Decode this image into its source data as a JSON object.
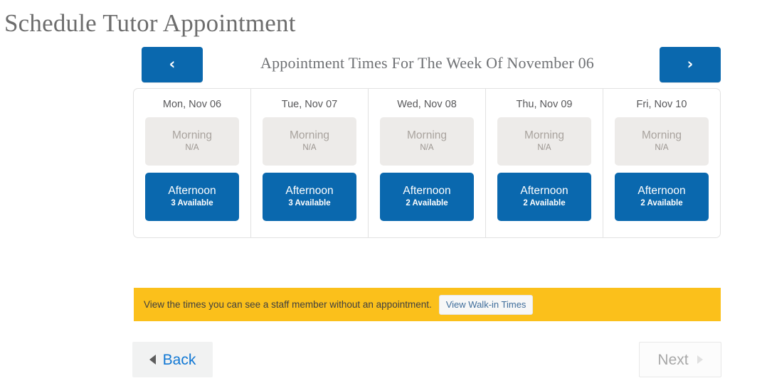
{
  "page": {
    "title": "Schedule Tutor Appointment"
  },
  "week_nav": {
    "prev_icon": "chevron-left-icon",
    "prev_glyph": "‹",
    "next_icon": "chevron-right-icon",
    "next_glyph": "›",
    "label": "Appointment Times For The Week Of November 06"
  },
  "week": {
    "days": [
      {
        "header": "Mon, Nov 06",
        "slots": [
          {
            "name": "Morning",
            "sub": "N/A",
            "state": "unavailable"
          },
          {
            "name": "Afternoon",
            "sub": "3 Available",
            "state": "available"
          }
        ]
      },
      {
        "header": "Tue, Nov 07",
        "slots": [
          {
            "name": "Morning",
            "sub": "N/A",
            "state": "unavailable"
          },
          {
            "name": "Afternoon",
            "sub": "3 Available",
            "state": "available"
          }
        ]
      },
      {
        "header": "Wed, Nov 08",
        "slots": [
          {
            "name": "Morning",
            "sub": "N/A",
            "state": "unavailable"
          },
          {
            "name": "Afternoon",
            "sub": "2 Available",
            "state": "available"
          }
        ]
      },
      {
        "header": "Thu, Nov 09",
        "slots": [
          {
            "name": "Morning",
            "sub": "N/A",
            "state": "unavailable"
          },
          {
            "name": "Afternoon",
            "sub": "2 Available",
            "state": "available"
          }
        ]
      },
      {
        "header": "Fri, Nov 10",
        "slots": [
          {
            "name": "Morning",
            "sub": "N/A",
            "state": "unavailable"
          },
          {
            "name": "Afternoon",
            "sub": "2 Available",
            "state": "available"
          }
        ]
      }
    ]
  },
  "walkin": {
    "message": "View the times you can see a staff member without an appointment.",
    "button_label": "View Walk-in Times"
  },
  "footer": {
    "back_label": "Back",
    "back_icon": "triangle-left-icon",
    "next_label": "Next",
    "next_icon": "triangle-right-icon",
    "next_disabled": true
  },
  "colors": {
    "accent_blue": "#0a68ae",
    "banner_yellow": "#fbc01b",
    "slot_grey": "#edebe9",
    "link_blue": "#1178d4",
    "title_grey": "#6d6d6d"
  }
}
